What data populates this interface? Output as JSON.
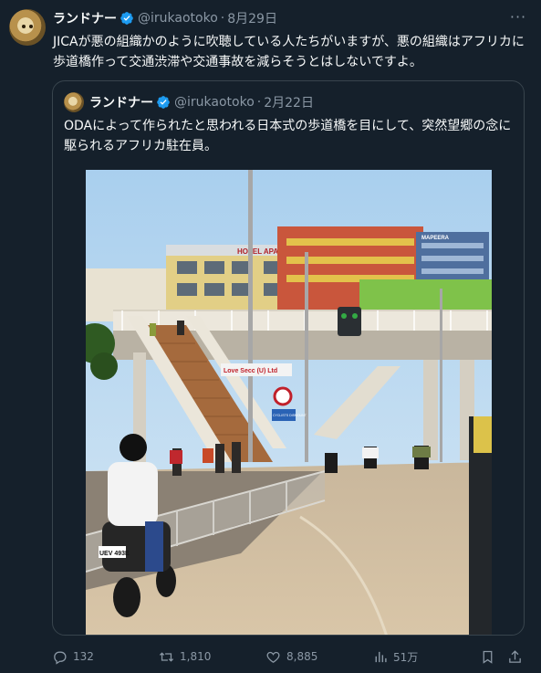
{
  "tweet": {
    "author_name": "ランドナー",
    "handle": "@irukaotoko",
    "separator": "·",
    "date": "8月29日",
    "more_label": "···",
    "text": "JICAが悪の組織かのように吹聴している人たちがいますが、悪の組織はアフリカに歩道橋作って交通渋滞や交通事故を減らそうとはしないですよ。"
  },
  "quote": {
    "author_name": "ランドナー",
    "handle": "@irukaotoko",
    "separator": "·",
    "date": "2月22日",
    "text": "ODAによって作られたと思われる日本式の歩道橋を目にして、突然望郷の念に駆られるアフリカ駐在員。",
    "photo": {
      "hotel_sign": "HOTEL APARTMENT",
      "blue_building_sign": "MAPEERA",
      "banner_text": "Love Secc (U) Ltd",
      "road_sign": "CYCLISTS DISMOUNT",
      "plate": "UEV 493E"
    }
  },
  "actions": {
    "replies": "132",
    "retweets": "1,810",
    "likes": "8,885",
    "views": "51万"
  },
  "colors": {
    "background": "#15202b",
    "text": "#f7f9f9",
    "muted": "#8b98a5",
    "border": "#38444d",
    "verified": "#1d9bf0"
  }
}
